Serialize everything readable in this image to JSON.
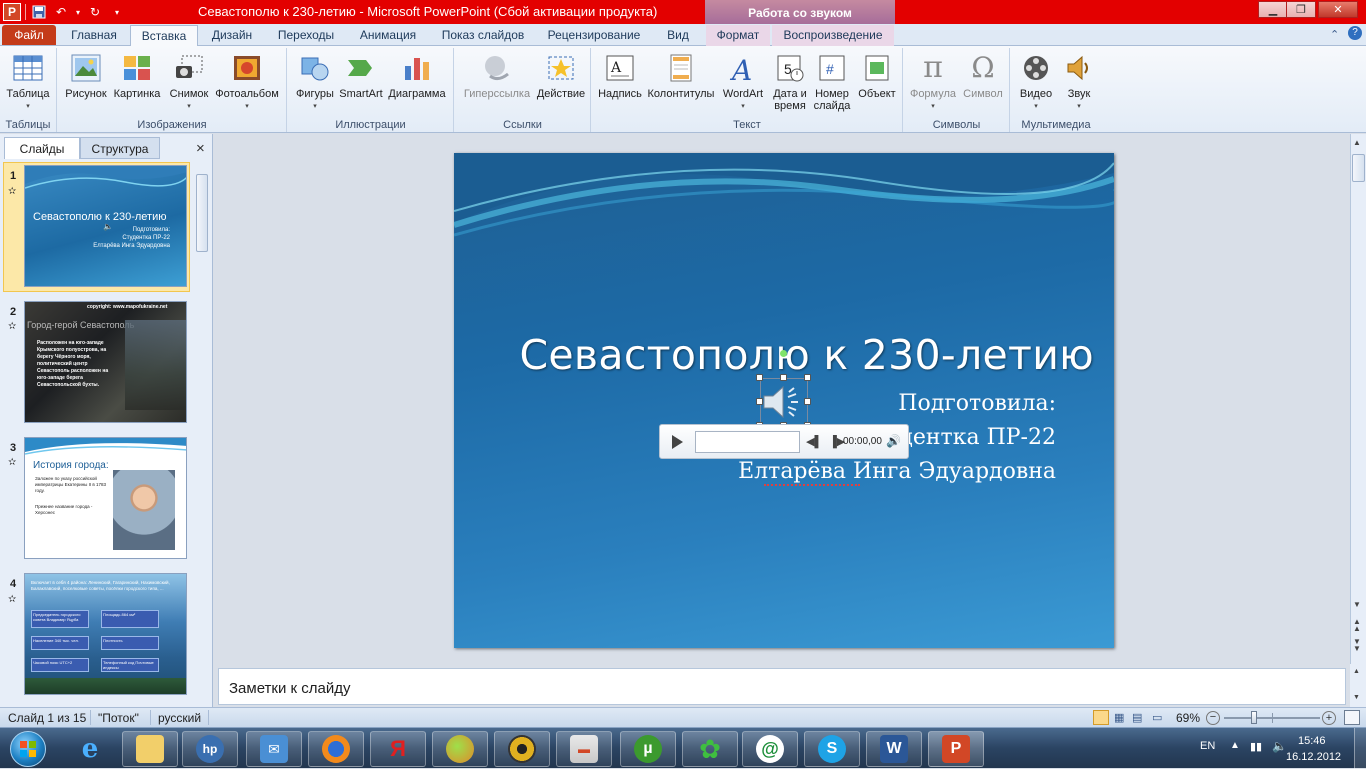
{
  "titlebar": {
    "title": "Севастополю к 230-летию  -  Microsoft PowerPoint (Сбой активации продукта)",
    "context_group": "Работа со звуком"
  },
  "tabs": [
    {
      "label": "Файл"
    },
    {
      "label": "Главная"
    },
    {
      "label": "Вставка"
    },
    {
      "label": "Дизайн"
    },
    {
      "label": "Переходы"
    },
    {
      "label": "Анимация"
    },
    {
      "label": "Показ слайдов"
    },
    {
      "label": "Рецензирование"
    },
    {
      "label": "Вид"
    },
    {
      "label": "Формат"
    },
    {
      "label": "Воспроизведение"
    }
  ],
  "ribbon": {
    "groups": [
      {
        "label": "Таблицы",
        "buttons": [
          "Таблица"
        ]
      },
      {
        "label": "Изображения",
        "buttons": [
          "Рисунок",
          "Картинка",
          "Снимок",
          "Фотоальбом"
        ]
      },
      {
        "label": "Иллюстрации",
        "buttons": [
          "Фигуры",
          "SmartArt",
          "Диаграмма"
        ]
      },
      {
        "label": "Ссылки",
        "buttons": [
          "Гиперссылка",
          "Действие"
        ]
      },
      {
        "label": "Текст",
        "buttons": [
          "Надпись",
          "Колонтитулы",
          "WordArt",
          "Дата и",
          "время",
          "Номер",
          "слайда",
          "Объект"
        ]
      },
      {
        "label": "Символы",
        "buttons": [
          "Формула",
          "Символ"
        ]
      },
      {
        "label": "Мультимедиа",
        "buttons": [
          "Видео",
          "Звук"
        ]
      }
    ]
  },
  "leftpanel": {
    "tab_slides": "Слайды",
    "tab_outline": "Структура",
    "close": "×",
    "thumbs": [
      {
        "num": "1",
        "title": "Севастополю к 230-летию",
        "lines": [
          "Подготовила:",
          "Студентка ПР-22",
          "Елтарёва Инга Эдуардовна"
        ]
      },
      {
        "num": "2",
        "title": "Город-герой Севастополь",
        "caption": "copyright: www.mapofukraine.net",
        "body": "Расположен на юго-западе Крымского полуострова, на берегу Чёрного моря, политический центр Севастополь расположен на юго-западе берега Севастопольской бухты."
      },
      {
        "num": "3",
        "title": "История города:",
        "bullets": [
          "Заложен по указу российской императрицы Екатерины II в 1783 году.",
          "Прежнее название города - Херсонес"
        ]
      },
      {
        "num": "4",
        "lines": [
          "Включает в себя 4 района: Ленинский, Гагаринский, Нахимовский, Балаклавский, поселковые советы, посёлки городского типа, ...",
          "Председатель городского совета",
          "Владимир Яцуба",
          "Площадь",
          "864 км²",
          "Население",
          "340 тыс. чел.",
          "Плотность",
          "Часовой пояс",
          "UTC+2",
          "Телефонный код",
          "Почтовые индексы"
        ]
      }
    ]
  },
  "slide": {
    "title": "Севастополю к 230-летию",
    "sub1": "Подготовила:",
    "sub2_visible": "дентка ПР-22",
    "sub3": "Елтарёва Инга Эдуардовна",
    "player_time": "00:00,00"
  },
  "notes": {
    "placeholder": "Заметки к слайду"
  },
  "statusbar": {
    "slide_info": "Слайд 1 из 15",
    "theme": "\"Поток\"",
    "language": "русский",
    "zoom": "69%"
  },
  "taskbar": {
    "lang": "EN",
    "time": "15:46",
    "date": "16.12.2012"
  }
}
